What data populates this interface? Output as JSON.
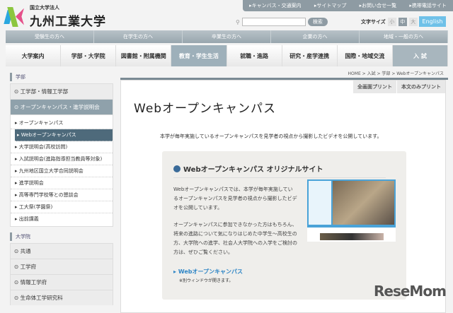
{
  "header": {
    "logo_small": "国立大学法人",
    "logo_big": "九州工業大学",
    "util_links": [
      "キャンバス・交通案内",
      "サイトマップ",
      "お問い合せ一覧",
      "携帯電話サイト"
    ],
    "search_button": "検索",
    "font_size_label": "文字サイズ",
    "font_sizes": [
      "小",
      "中",
      "大"
    ],
    "english": "English"
  },
  "audience_nav": [
    "受験生の方へ",
    "在学生の方へ",
    "卒業生の方へ",
    "企業の方へ",
    "地域・一般の方へ"
  ],
  "main_nav": [
    "大学案内",
    "学部・大学院",
    "図書館・附属機関",
    "教育・学生生活",
    "就職・進路",
    "研究・産学連携",
    "国際・地域交流",
    "入 試"
  ],
  "sidebar": {
    "section1": "学部",
    "items1": [
      "工学部・情報工学部",
      "オープンキャンパス・進学説明会"
    ],
    "subitems": [
      "オープンキャンパス",
      "Webオープンキャンパス",
      "大学説明会(高校訪問)",
      "入試説明会(進路指導担当教員等対象)",
      "九州地区国立大学合同説明会",
      "進学説明会",
      "高等専門学校等との懇談会",
      "工大祭(学園祭)",
      "出前講義"
    ],
    "section2": "大学院",
    "items2": [
      "共通",
      "工学府",
      "情報工学府",
      "生命体工学研究科"
    ]
  },
  "breadcrumb": "HOME > 入試 > 学部 > Webオープンキャンパス",
  "print_buttons": [
    "全画面プリント",
    "本文のみプリント"
  ],
  "title": "Webオープンキャンパス",
  "description": "本学が毎年実施しているオープンキャンパスを見学者の視点から撮影したビデオを公開しています。",
  "box": {
    "heading": "Webオープンキャンパス オリジナルサイト",
    "para1": "Webオープンキャンパスでは、本学が毎年実施しているオープンキャンパスを見学者の視点から撮影したビデオを公開しています。",
    "para2": "オープンキャンパスに参加できなかった方はもちろん、将来の進路について気になりはじめた中学生～高校生の方、大学院への進学、社会人大学院への入学をご検討の方は、ぜひご覧ください。",
    "link": "Webオープンキャンパス",
    "note": "※別ウィンドウが開きます。"
  },
  "watermark": "ReseMom"
}
